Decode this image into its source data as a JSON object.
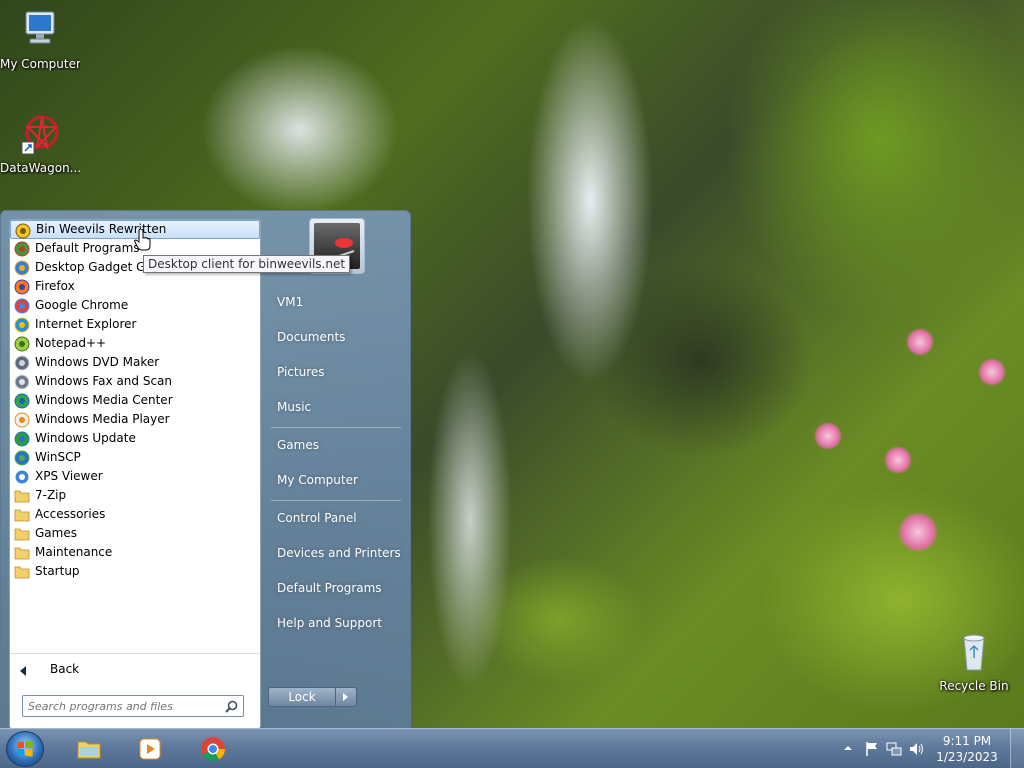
{
  "desktop": {
    "icons": [
      {
        "label": "My Computer",
        "icon": "my-computer-icon"
      },
      {
        "label": "DataWagon...",
        "icon": "datawagon-shortcut-icon"
      },
      {
        "label": "Recycle Bin",
        "icon": "recycle-bin-icon"
      }
    ]
  },
  "start_menu": {
    "programs": [
      {
        "label": "Bin Weevils Rewritten",
        "icon": "bin-weevils-icon"
      },
      {
        "label": "Default Programs",
        "icon": "default-programs-icon"
      },
      {
        "label": "Desktop Gadget Gall",
        "icon": "gadget-gallery-icon"
      },
      {
        "label": "Firefox",
        "icon": "firefox-icon"
      },
      {
        "label": "Google Chrome",
        "icon": "chrome-icon"
      },
      {
        "label": "Internet Explorer",
        "icon": "internet-explorer-icon"
      },
      {
        "label": "Notepad++",
        "icon": "notepad-plus-plus-icon"
      },
      {
        "label": "Windows DVD Maker",
        "icon": "dvd-maker-icon"
      },
      {
        "label": "Windows Fax and Scan",
        "icon": "fax-scan-icon"
      },
      {
        "label": "Windows Media Center",
        "icon": "media-center-icon"
      },
      {
        "label": "Windows Media Player",
        "icon": "media-player-icon"
      },
      {
        "label": "Windows Update",
        "icon": "windows-update-icon"
      },
      {
        "label": "WinSCP",
        "icon": "winscp-icon"
      },
      {
        "label": "XPS Viewer",
        "icon": "xps-viewer-icon"
      },
      {
        "label": "7-Zip",
        "icon": "folder-icon"
      },
      {
        "label": "Accessories",
        "icon": "folder-icon"
      },
      {
        "label": "Games",
        "icon": "folder-icon"
      },
      {
        "label": "Maintenance",
        "icon": "folder-icon"
      },
      {
        "label": "Startup",
        "icon": "folder-icon"
      }
    ],
    "selected_program": "Bin Weevils Rewritten",
    "tooltip": "Desktop client for binweevils.net",
    "back_label": "Back",
    "search_placeholder": "Search programs and files",
    "right_pane": {
      "user": "VM1",
      "links": [
        "Documents",
        "Pictures",
        "Music",
        "Games",
        "My Computer",
        "Control Panel",
        "Devices and Printers",
        "Default Programs",
        "Help and Support"
      ]
    },
    "lock_label": "Lock"
  },
  "taskbar": {
    "pinned": [
      {
        "icon": "windows-explorer-icon"
      },
      {
        "icon": "media-player-icon"
      },
      {
        "icon": "chrome-icon"
      }
    ],
    "tray_icons": [
      "show-hidden-icons-arrow-icon",
      "action-center-flag-icon",
      "network-icon",
      "volume-icon"
    ],
    "clock": {
      "time": "9:11 PM",
      "date": "1/23/2023"
    }
  },
  "colors": {
    "start_menu_glass": "#6f8aa6",
    "taskbar": "#5f7a9c",
    "selection": "#c9e0f8"
  }
}
